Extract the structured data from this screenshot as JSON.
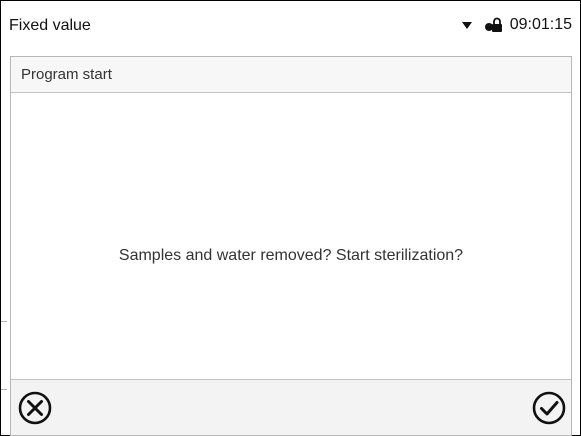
{
  "statusbar": {
    "title": "Fixed value",
    "time": "09:01:15",
    "icons": [
      "chevron-down-icon",
      "lock-icon"
    ]
  },
  "dialog": {
    "title": "Program start",
    "message": "Samples and water removed? Start sterilization?",
    "buttons": [
      {
        "name": "cancel",
        "icon": "close-circle-icon"
      },
      {
        "name": "confirm",
        "icon": "check-circle-icon"
      }
    ]
  },
  "colors": {
    "border": "#b7b7b7",
    "header_bg": "#f7f7f7",
    "footer_bg": "#f3f3f3",
    "text": "#333333"
  }
}
